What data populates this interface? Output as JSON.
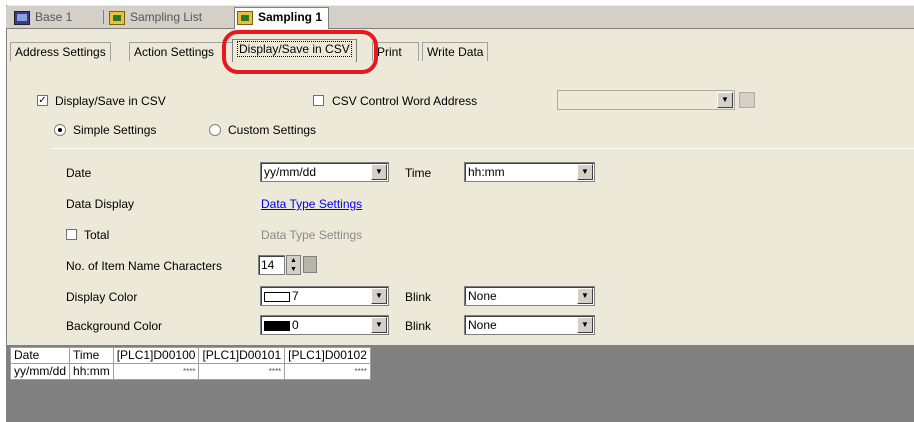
{
  "doc_tabs": [
    {
      "label": "Base 1",
      "icon": "screen-icon"
    },
    {
      "label": "Sampling List",
      "icon": "sampling-list-icon"
    },
    {
      "label": "Sampling 1",
      "icon": "sampling-icon",
      "active": true
    }
  ],
  "settings_tabs": [
    {
      "label": "Address Settings"
    },
    {
      "label": "Action Settings"
    },
    {
      "label": "Display/Save in CSV",
      "selected": true
    },
    {
      "label": "Print"
    },
    {
      "label": "Write Data"
    }
  ],
  "form": {
    "display_save_csv": {
      "label": "Display/Save in CSV",
      "checked": true
    },
    "csv_control_word": {
      "label": "CSV Control Word Address",
      "checked": false,
      "value": ""
    },
    "simple_settings": {
      "label": "Simple Settings",
      "selected": true
    },
    "custom_settings": {
      "label": "Custom Settings",
      "selected": false
    },
    "date": {
      "label": "Date",
      "value": "yy/mm/dd"
    },
    "time": {
      "label": "Time",
      "value": "hh:mm"
    },
    "data_display": {
      "label": "Data Display",
      "link": "Data Type Settings"
    },
    "total": {
      "label": "Total",
      "checked": false,
      "link_disabled": "Data Type Settings"
    },
    "item_name_chars": {
      "label": "No. of Item Name Characters",
      "value": "14"
    },
    "display_color": {
      "label": "Display Color",
      "value": "7",
      "swatch": "#ffffff",
      "blink_label": "Blink",
      "blink": "None"
    },
    "background_color": {
      "label": "Background Color",
      "value": "0",
      "swatch": "#000000",
      "blink_label": "Blink",
      "blink": "None"
    }
  },
  "preview_table": {
    "headers": [
      "Date",
      "Time",
      "[PLC1]D00100",
      "[PLC1]D00101",
      "[PLC1]D00102"
    ],
    "row": [
      "yy/mm/dd",
      "hh:mm",
      "****",
      "****",
      "****"
    ]
  },
  "colors": {
    "highlight": "#e8191e",
    "link": "#0000ee"
  }
}
